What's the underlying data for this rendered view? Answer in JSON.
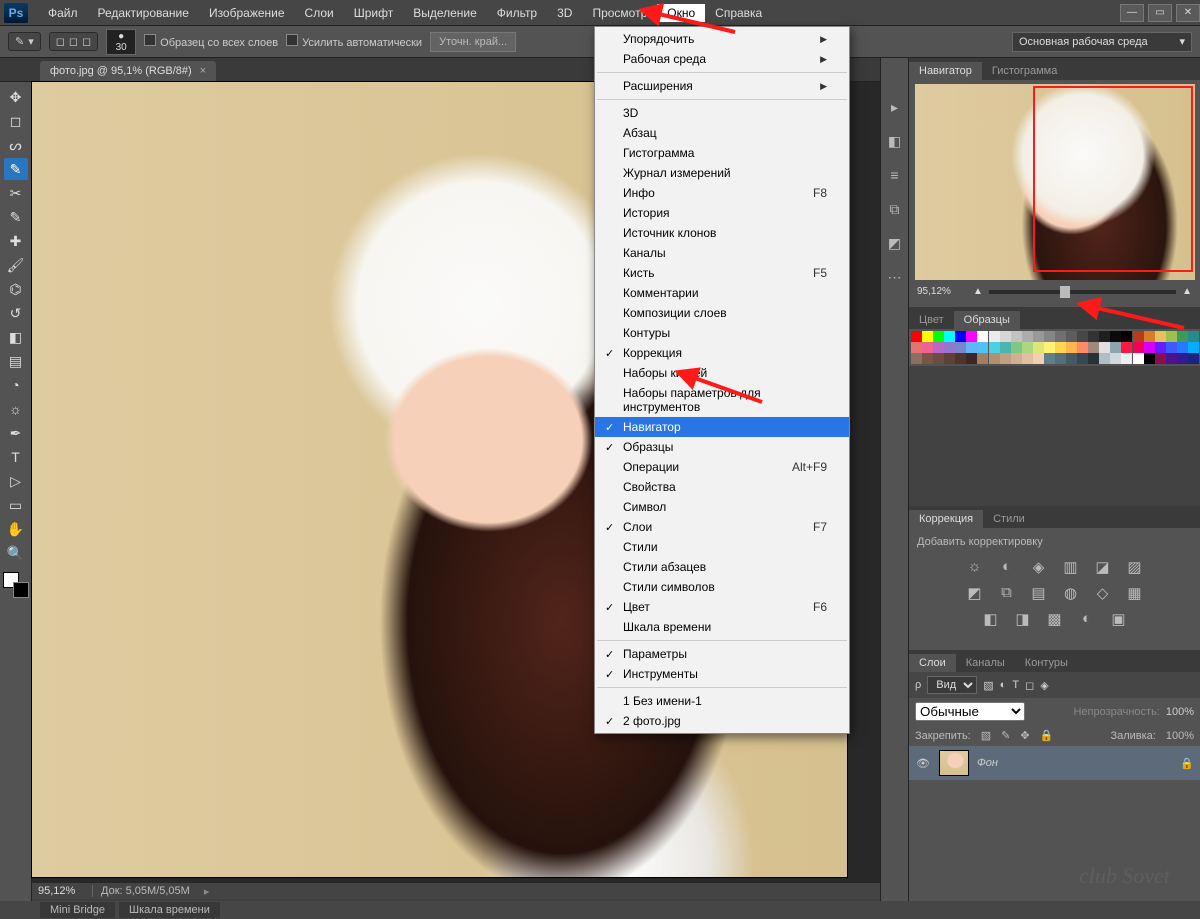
{
  "app": {
    "logo": "Ps"
  },
  "menubar": {
    "items": [
      "Файл",
      "Редактирование",
      "Изображение",
      "Слои",
      "Шрифт",
      "Выделение",
      "Фильтр",
      "3D",
      "Просмотр",
      "Окно",
      "Справка"
    ],
    "open_index": 9
  },
  "optbar": {
    "brush_size": "30",
    "chk1_label": "Образец со всех слоев",
    "chk2_label": "Усилить автоматически",
    "btn_refine": "Уточн. край...",
    "workspace_label": "Основная рабочая среда"
  },
  "doc_tab": {
    "title": "фото.jpg @ 95,1% (RGB/8#)"
  },
  "dropdown": {
    "groups": [
      [
        {
          "label": "Упорядочить",
          "submenu": true
        },
        {
          "label": "Рабочая среда",
          "submenu": true
        }
      ],
      [
        {
          "label": "Расширения",
          "submenu": true
        }
      ],
      [
        {
          "label": "3D"
        },
        {
          "label": "Абзац"
        },
        {
          "label": "Гистограмма"
        },
        {
          "label": "Журнал измерений"
        },
        {
          "label": "Инфо",
          "shortcut": "F8"
        },
        {
          "label": "История"
        },
        {
          "label": "Источник клонов"
        },
        {
          "label": "Каналы"
        },
        {
          "label": "Кисть",
          "shortcut": "F5"
        },
        {
          "label": "Комментарии"
        },
        {
          "label": "Композиции слоев"
        },
        {
          "label": "Контуры"
        },
        {
          "label": "Коррекция",
          "checked": true
        },
        {
          "label": "Наборы кистей"
        },
        {
          "label": "Наборы параметров для инструментов"
        },
        {
          "label": "Навигатор",
          "checked": true,
          "selected": true
        },
        {
          "label": "Образцы",
          "checked": true
        },
        {
          "label": "Операции",
          "shortcut": "Alt+F9"
        },
        {
          "label": "Свойства"
        },
        {
          "label": "Символ"
        },
        {
          "label": "Слои",
          "checked": true,
          "shortcut": "F7"
        },
        {
          "label": "Стили"
        },
        {
          "label": "Стили абзацев"
        },
        {
          "label": "Стили символов"
        },
        {
          "label": "Цвет",
          "checked": true,
          "shortcut": "F6"
        },
        {
          "label": "Шкала времени"
        }
      ],
      [
        {
          "label": "Параметры",
          "checked": true
        },
        {
          "label": "Инструменты",
          "checked": true
        }
      ],
      [
        {
          "label": "1 Без имени-1"
        },
        {
          "label": "2 фото.jpg",
          "checked": true
        }
      ]
    ]
  },
  "navigator": {
    "tab1": "Навигатор",
    "tab2": "Гистограмма",
    "zoom": "95,12%"
  },
  "color_panel": {
    "tab1": "Цвет",
    "tab2": "Образцы"
  },
  "corrections": {
    "tab1": "Коррекция",
    "tab2": "Стили",
    "title": "Добавить корректировку"
  },
  "layers": {
    "tab1": "Слои",
    "tab2": "Каналы",
    "tab3": "Контуры",
    "kind_label": "Вид",
    "blend": "Обычные",
    "opacity_label": "Непрозрачность:",
    "opacity": "100%",
    "lock_label": "Закрепить:",
    "fill_label": "Заливка:",
    "fill": "100%",
    "layer0": "Фон"
  },
  "canvas": {
    "zoom": "95,12%",
    "docinfo": "Док: 5,05M/5,05M"
  },
  "statusbar": {
    "tab1": "Mini Bridge",
    "tab2": "Шкала времени"
  },
  "watermark": "club Sovet",
  "swatch_colors": [
    "#ff0000",
    "#ffff00",
    "#00ff00",
    "#00ffff",
    "#0000ff",
    "#ff00ff",
    "#ffffff",
    "#ebebeb",
    "#d6d6d6",
    "#c2c2c2",
    "#adadad",
    "#999999",
    "#858585",
    "#707070",
    "#5c5c5c",
    "#474747",
    "#333333",
    "#1f1f1f",
    "#0a0a0a",
    "#000000",
    "#b43c1a",
    "#d87b2a",
    "#e6c25a",
    "#9cc24d",
    "#3d9a5a",
    "#2a8a8a",
    "#e57373",
    "#f06292",
    "#ba68c8",
    "#9575cd",
    "#7986cb",
    "#64b5f6",
    "#4fc3f7",
    "#4dd0e1",
    "#4db6ac",
    "#81c784",
    "#aed581",
    "#dce775",
    "#fff176",
    "#ffd54f",
    "#ffb74d",
    "#ff8a65",
    "#a1887f",
    "#e0e0e0",
    "#90a4ae",
    "#ff1744",
    "#f50057",
    "#d500f9",
    "#651fff",
    "#3d5afe",
    "#2979ff",
    "#00b0ff",
    "#8d6e63",
    "#795548",
    "#6d4c41",
    "#5d4037",
    "#4e342e",
    "#3e2723",
    "#a08060",
    "#b09070",
    "#c0a080",
    "#d0b090",
    "#e0c0a0",
    "#f0d0b0",
    "#607d8b",
    "#546e7a",
    "#455a64",
    "#37474f",
    "#263238",
    "#b0bec5",
    "#cfd8dc",
    "#eceff1",
    "#ffffff",
    "#000000",
    "#880e4f",
    "#4a148c",
    "#311b92",
    "#1a237e"
  ]
}
